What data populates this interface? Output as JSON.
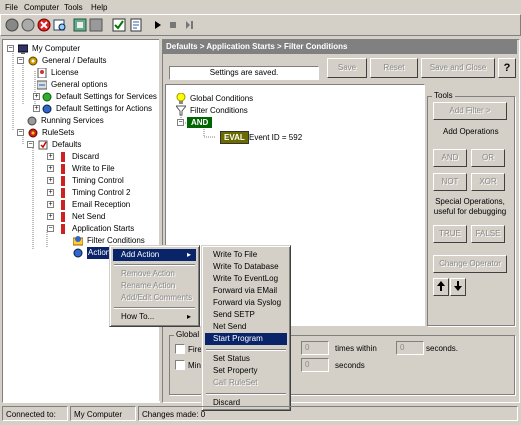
{
  "menubar": [
    "File",
    "Computer",
    "Tools",
    "Help"
  ],
  "toolbar": {
    "icons": [
      "connect-icon",
      "refresh-icon",
      "delete-icon",
      "find-icon",
      "export-icon",
      "grid-icon",
      "check-icon",
      "script-icon",
      "play-icon",
      "stop-icon",
      "step-icon"
    ]
  },
  "tree": {
    "items": [
      {
        "label": "My Computer"
      },
      {
        "label": "General / Defaults"
      },
      {
        "label": "License"
      },
      {
        "label": "General options"
      },
      {
        "label": "Default Settings for Services"
      },
      {
        "label": "Default Settings for Actions"
      },
      {
        "label": "Running Services"
      },
      {
        "label": "RuleSets"
      },
      {
        "label": "Defaults"
      },
      {
        "label": "Discard"
      },
      {
        "label": "Write to File"
      },
      {
        "label": "Timing Control"
      },
      {
        "label": "Timing Control 2"
      },
      {
        "label": "Email Reception"
      },
      {
        "label": "Net Send"
      },
      {
        "label": "Application Starts"
      },
      {
        "label": "Filter Conditions"
      },
      {
        "label": "Actions"
      }
    ]
  },
  "panel": {
    "breadcrumb": "Defaults > Application Starts > Filter Conditions",
    "status_message": "Settings are saved.",
    "save_label": "Save",
    "reset_label": "Reset",
    "save_close_label": "Save and Close",
    "help_label": "?"
  },
  "conditions": {
    "global": "Global Conditions",
    "filter": "Filter Conditions",
    "and": "AND",
    "eval": "EVAL",
    "expression": "Event ID = 592"
  },
  "tools": {
    "title": "Tools",
    "add_filter": "Add Filter >",
    "add_operations": "Add Operations",
    "and": "AND",
    "or": "OR",
    "not": "NOT",
    "xor": "XOR",
    "special_ops": "Special Operations, useful for debugging",
    "true": "TRUE",
    "false": "FALSE",
    "change_operator": "Change Operator"
  },
  "global_section": {
    "title": "Global Co",
    "fire_label": "Fire",
    "min_label": "Min",
    "value1": "0",
    "value2": "0",
    "value3": "0",
    "times_within": "times within",
    "seconds1": "seconds.",
    "seconds2": "seconds"
  },
  "context_menu": {
    "items": [
      "Add Action",
      "Remove Action",
      "Rename Action",
      "Add/Edit Comments",
      "How To..."
    ]
  },
  "submenu": {
    "items": [
      "Write To File",
      "Write To Database",
      "Write To EventLog",
      "Forward via EMail",
      "Forward via Syslog",
      "Send SETP",
      "Net Send",
      "Start Program",
      "Set Status",
      "Set Property",
      "Call RuleSet",
      "Discard"
    ]
  },
  "statusbar": {
    "connected_label": "Connected to:",
    "computer": "My Computer",
    "changes": "Changes made: 0"
  }
}
